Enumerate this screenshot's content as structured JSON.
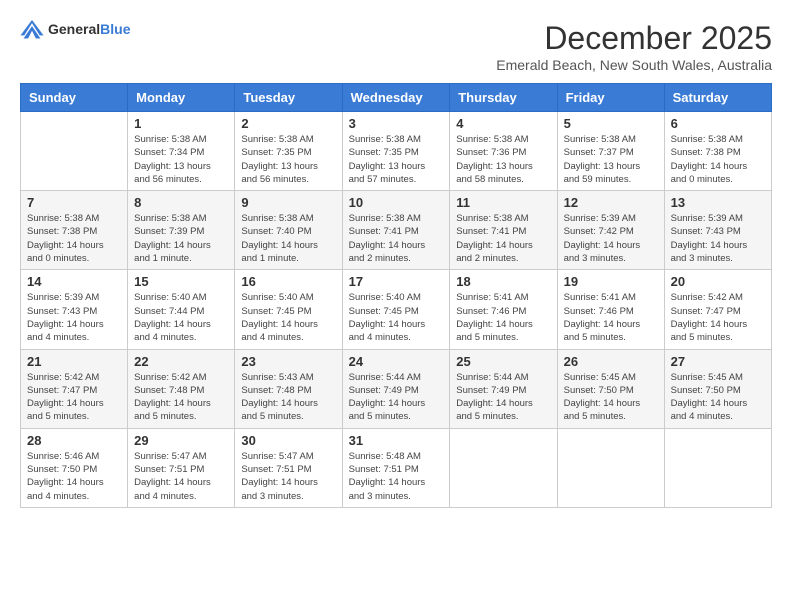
{
  "header": {
    "logo": {
      "text_general": "General",
      "text_blue": "Blue"
    },
    "title": "December 2025",
    "location": "Emerald Beach, New South Wales, Australia"
  },
  "calendar": {
    "columns": [
      "Sunday",
      "Monday",
      "Tuesday",
      "Wednesday",
      "Thursday",
      "Friday",
      "Saturday"
    ],
    "weeks": [
      [
        {
          "day": "",
          "info": ""
        },
        {
          "day": "1",
          "info": "Sunrise: 5:38 AM\nSunset: 7:34 PM\nDaylight: 13 hours\nand 56 minutes."
        },
        {
          "day": "2",
          "info": "Sunrise: 5:38 AM\nSunset: 7:35 PM\nDaylight: 13 hours\nand 56 minutes."
        },
        {
          "day": "3",
          "info": "Sunrise: 5:38 AM\nSunset: 7:35 PM\nDaylight: 13 hours\nand 57 minutes."
        },
        {
          "day": "4",
          "info": "Sunrise: 5:38 AM\nSunset: 7:36 PM\nDaylight: 13 hours\nand 58 minutes."
        },
        {
          "day": "5",
          "info": "Sunrise: 5:38 AM\nSunset: 7:37 PM\nDaylight: 13 hours\nand 59 minutes."
        },
        {
          "day": "6",
          "info": "Sunrise: 5:38 AM\nSunset: 7:38 PM\nDaylight: 14 hours\nand 0 minutes."
        }
      ],
      [
        {
          "day": "7",
          "info": "Sunrise: 5:38 AM\nSunset: 7:38 PM\nDaylight: 14 hours\nand 0 minutes."
        },
        {
          "day": "8",
          "info": "Sunrise: 5:38 AM\nSunset: 7:39 PM\nDaylight: 14 hours\nand 1 minute."
        },
        {
          "day": "9",
          "info": "Sunrise: 5:38 AM\nSunset: 7:40 PM\nDaylight: 14 hours\nand 1 minute."
        },
        {
          "day": "10",
          "info": "Sunrise: 5:38 AM\nSunset: 7:41 PM\nDaylight: 14 hours\nand 2 minutes."
        },
        {
          "day": "11",
          "info": "Sunrise: 5:38 AM\nSunset: 7:41 PM\nDaylight: 14 hours\nand 2 minutes."
        },
        {
          "day": "12",
          "info": "Sunrise: 5:39 AM\nSunset: 7:42 PM\nDaylight: 14 hours\nand 3 minutes."
        },
        {
          "day": "13",
          "info": "Sunrise: 5:39 AM\nSunset: 7:43 PM\nDaylight: 14 hours\nand 3 minutes."
        }
      ],
      [
        {
          "day": "14",
          "info": "Sunrise: 5:39 AM\nSunset: 7:43 PM\nDaylight: 14 hours\nand 4 minutes."
        },
        {
          "day": "15",
          "info": "Sunrise: 5:40 AM\nSunset: 7:44 PM\nDaylight: 14 hours\nand 4 minutes."
        },
        {
          "day": "16",
          "info": "Sunrise: 5:40 AM\nSunset: 7:45 PM\nDaylight: 14 hours\nand 4 minutes."
        },
        {
          "day": "17",
          "info": "Sunrise: 5:40 AM\nSunset: 7:45 PM\nDaylight: 14 hours\nand 4 minutes."
        },
        {
          "day": "18",
          "info": "Sunrise: 5:41 AM\nSunset: 7:46 PM\nDaylight: 14 hours\nand 5 minutes."
        },
        {
          "day": "19",
          "info": "Sunrise: 5:41 AM\nSunset: 7:46 PM\nDaylight: 14 hours\nand 5 minutes."
        },
        {
          "day": "20",
          "info": "Sunrise: 5:42 AM\nSunset: 7:47 PM\nDaylight: 14 hours\nand 5 minutes."
        }
      ],
      [
        {
          "day": "21",
          "info": "Sunrise: 5:42 AM\nSunset: 7:47 PM\nDaylight: 14 hours\nand 5 minutes."
        },
        {
          "day": "22",
          "info": "Sunrise: 5:42 AM\nSunset: 7:48 PM\nDaylight: 14 hours\nand 5 minutes."
        },
        {
          "day": "23",
          "info": "Sunrise: 5:43 AM\nSunset: 7:48 PM\nDaylight: 14 hours\nand 5 minutes."
        },
        {
          "day": "24",
          "info": "Sunrise: 5:44 AM\nSunset: 7:49 PM\nDaylight: 14 hours\nand 5 minutes."
        },
        {
          "day": "25",
          "info": "Sunrise: 5:44 AM\nSunset: 7:49 PM\nDaylight: 14 hours\nand 5 minutes."
        },
        {
          "day": "26",
          "info": "Sunrise: 5:45 AM\nSunset: 7:50 PM\nDaylight: 14 hours\nand 5 minutes."
        },
        {
          "day": "27",
          "info": "Sunrise: 5:45 AM\nSunset: 7:50 PM\nDaylight: 14 hours\nand 4 minutes."
        }
      ],
      [
        {
          "day": "28",
          "info": "Sunrise: 5:46 AM\nSunset: 7:50 PM\nDaylight: 14 hours\nand 4 minutes."
        },
        {
          "day": "29",
          "info": "Sunrise: 5:47 AM\nSunset: 7:51 PM\nDaylight: 14 hours\nand 4 minutes."
        },
        {
          "day": "30",
          "info": "Sunrise: 5:47 AM\nSunset: 7:51 PM\nDaylight: 14 hours\nand 3 minutes."
        },
        {
          "day": "31",
          "info": "Sunrise: 5:48 AM\nSunset: 7:51 PM\nDaylight: 14 hours\nand 3 minutes."
        },
        {
          "day": "",
          "info": ""
        },
        {
          "day": "",
          "info": ""
        },
        {
          "day": "",
          "info": ""
        }
      ]
    ]
  }
}
